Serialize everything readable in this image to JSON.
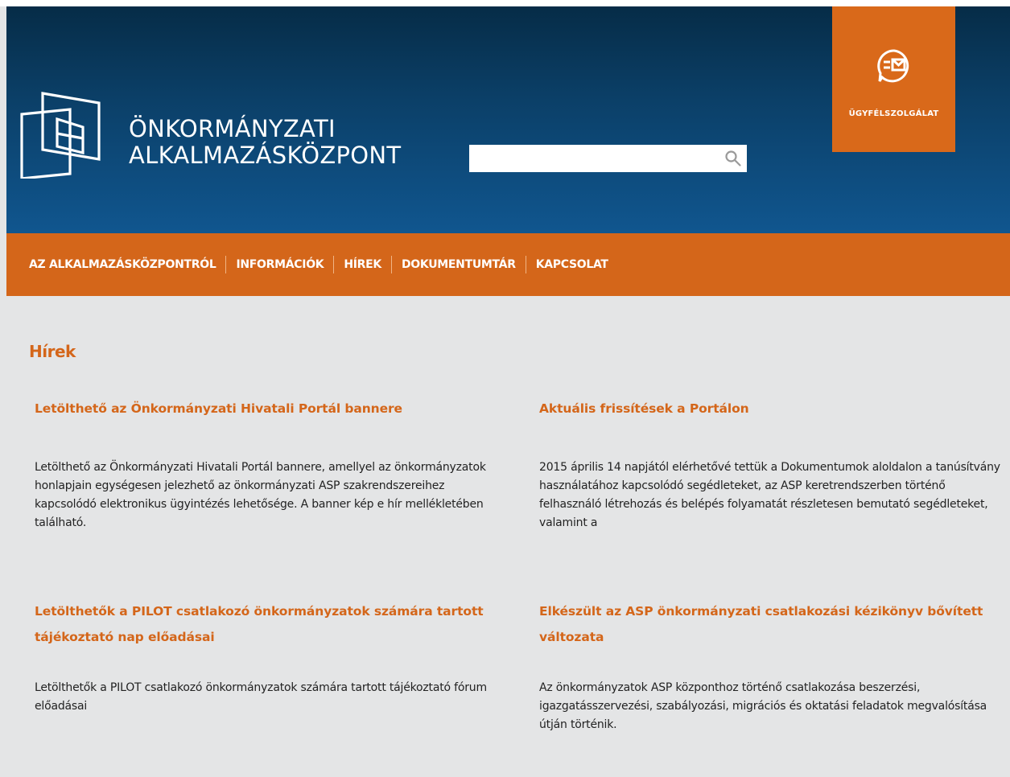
{
  "header": {
    "logo_line1": "ÖNKORMÁNYZATI",
    "logo_line2": "ALKALMAZÁSKÖZPONT",
    "search": {
      "placeholder": "",
      "value": ""
    },
    "service_label": "ÜGYFÉLSZOLGÁLAT"
  },
  "nav": {
    "items": [
      {
        "label": "AZ ALKALMAZÁSKÖZPONTRÓL"
      },
      {
        "label": "INFORMÁCIÓK"
      },
      {
        "label": "HÍREK"
      },
      {
        "label": "DOKUMENTUMTÁR"
      },
      {
        "label": "KAPCSOLAT"
      }
    ]
  },
  "page": {
    "title": "Hírek"
  },
  "news": [
    {
      "title": "Letölthető az Önkormányzati Hivatali Portál bannere",
      "text": "Letölthető az Önkormányzati Hivatali Portál bannere, amellyel az önkormányzatok honlapjain egységesen jelezhető az önkormányzati ASP szakrendszereihez kapcsolódó elektronikus ügyintézés lehetősége. A banner kép e hír mellékletében található."
    },
    {
      "title": "Aktuális frissítések a Portálon",
      "text": "2015 április 14 napjától elérhetővé tettük a Dokumentumok aloldalon a tanúsítvány használatához kapcsolódó segédleteket, az ASP keretrendszerben történő felhasználó létrehozás és belépés folyamatát részletesen bemutató segédleteket, valamint a"
    },
    {
      "title": "Letölthetők a PILOT csatlakozó önkormányzatok számára tartott tájékoztató nap előadásai",
      "text": "Letölthetők a PILOT csatlakozó önkormányzatok számára tartott tájékoztató fórum előadásai"
    },
    {
      "title": "Elkészült az ASP önkormányzati csatlakozási kézikönyv bővített változata",
      "text": "Az önkormányzatok ASP központhoz történő csatlakozása beszerzési, igazgatásszervezési, szabályozási, migrációs és oktatási feladatok megvalósítása útján történik."
    }
  ],
  "colors": {
    "accent": "#d4661a",
    "header_dark": "#062c47",
    "header_light": "#10568f",
    "background": "#e4e5e6"
  },
  "icons": [
    "logo-squares-icon",
    "search-icon",
    "envelope-chat-icon"
  ]
}
